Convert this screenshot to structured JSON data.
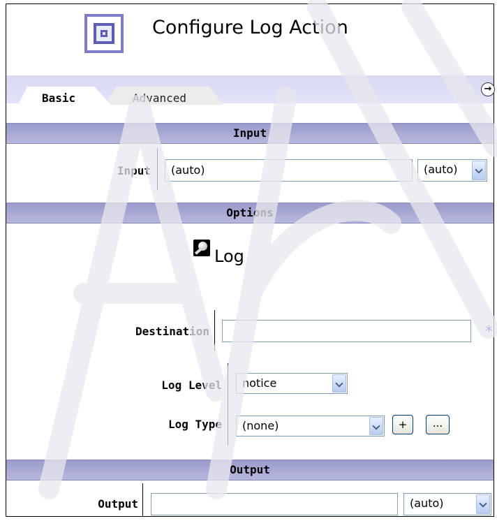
{
  "page": {
    "title": "Configure Log Action"
  },
  "tabs": [
    {
      "label": "Basic",
      "active": true
    },
    {
      "label": "Advanced",
      "active": false
    }
  ],
  "sections": {
    "input": "Input",
    "options": "Options",
    "output": "Output"
  },
  "input": {
    "label": "Input",
    "value": "(auto)",
    "type_value": "(auto)"
  },
  "options": {
    "log_heading": "Log",
    "destination": {
      "label": "Destination",
      "value": "",
      "required_mark": "*"
    },
    "log_level": {
      "label": "Log Level",
      "value": "notice"
    },
    "log_type": {
      "label": "Log Type",
      "value": "(none)",
      "add_label": "+",
      "browse_label": "..."
    }
  },
  "output": {
    "label": "Output",
    "value": "",
    "type_value": "(auto)"
  },
  "colors": {
    "section_bar": "#9a9acb",
    "tab_bar": "#d8d8f4",
    "required": "#2b2bd0"
  }
}
